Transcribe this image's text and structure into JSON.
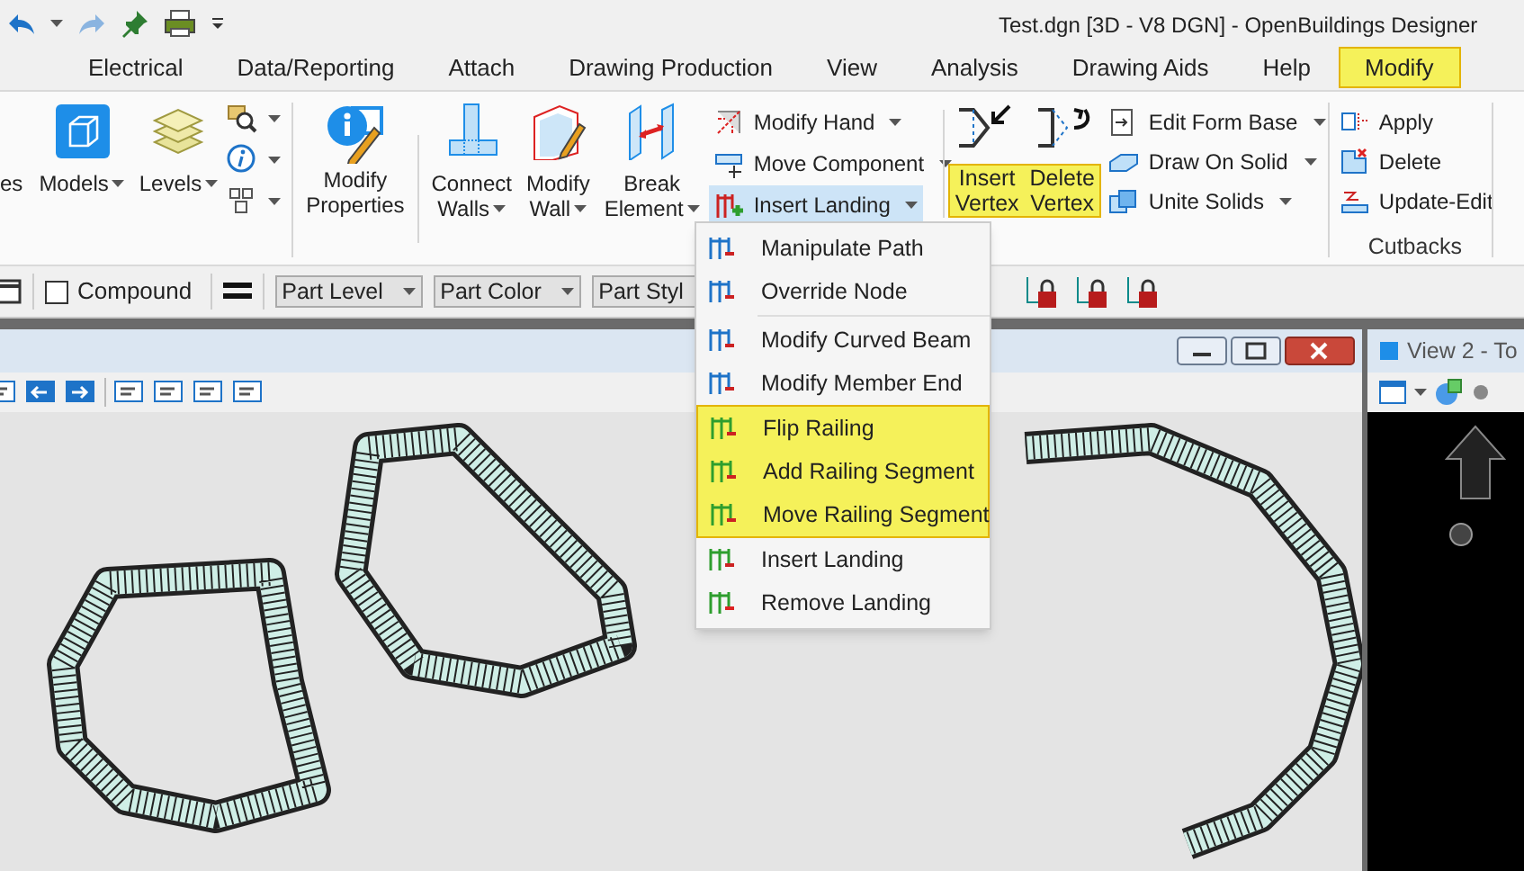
{
  "window": {
    "title": "Test.dgn [3D - V8 DGN] - OpenBuildings Designer"
  },
  "tabs": [
    {
      "label": "Electrical",
      "selected": false
    },
    {
      "label": "Data/Reporting",
      "selected": false
    },
    {
      "label": "Attach",
      "selected": false
    },
    {
      "label": "Drawing Production",
      "selected": false
    },
    {
      "label": "View",
      "selected": false
    },
    {
      "label": "Analysis",
      "selected": false
    },
    {
      "label": "Drawing Aids",
      "selected": false
    },
    {
      "label": "Help",
      "selected": false
    },
    {
      "label": "Modify",
      "selected": true
    }
  ],
  "ribbon": {
    "cut_label": "es",
    "large_buttons": [
      {
        "label": "Models",
        "kind": "models"
      },
      {
        "label": "Levels",
        "kind": "levels"
      }
    ],
    "properties_button": {
      "label_lines": [
        "Modify",
        "Properties"
      ]
    },
    "wall_buttons": [
      {
        "label_lines": [
          "Connect",
          "Walls"
        ],
        "kind": "connect"
      },
      {
        "label_lines": [
          "Modify",
          "Wall"
        ],
        "kind": "wall"
      },
      {
        "label_lines": [
          "Break",
          "Element"
        ],
        "kind": "break"
      }
    ],
    "small_buttons": [
      {
        "label": "Modify Hand",
        "open": false
      },
      {
        "label": "Move Component",
        "open": false
      },
      {
        "label": "Insert Landing",
        "open": true
      }
    ],
    "vertex_buttons": [
      {
        "label_lines": [
          "Insert",
          "Vertex"
        ],
        "highlighted": true
      },
      {
        "label_lines": [
          "Delete",
          "Vertex"
        ],
        "highlighted": true
      }
    ],
    "solid_buttons": [
      {
        "label": "Edit Form Base"
      },
      {
        "label": "Draw On Solid"
      },
      {
        "label": "Unite Solids"
      }
    ],
    "cutbacks": {
      "items": [
        "Apply",
        "Delete",
        "Update-Edit"
      ],
      "group_label": "Cutbacks"
    }
  },
  "menu": {
    "items": [
      {
        "kind": "item",
        "label": "Manipulate Path",
        "highlighted": false
      },
      {
        "kind": "item",
        "label": "Override Node",
        "highlighted": false
      },
      {
        "kind": "separator"
      },
      {
        "kind": "item",
        "label": "Modify Curved Beam",
        "highlighted": false
      },
      {
        "kind": "item",
        "label": "Modify Member End",
        "highlighted": false
      },
      {
        "kind": "item",
        "label": "Flip Railing",
        "highlighted": true
      },
      {
        "kind": "item",
        "label": "Add Railing Segment",
        "highlighted": true
      },
      {
        "kind": "item",
        "label": "Move Railing Segment",
        "highlighted": true
      },
      {
        "kind": "item",
        "label": "Insert Landing",
        "highlighted": false
      },
      {
        "kind": "item",
        "label": "Remove Landing",
        "highlighted": false
      }
    ]
  },
  "toolbar": {
    "compound": {
      "label": "Compound",
      "checked": false
    },
    "dropdowns": [
      {
        "value": "Part Level"
      },
      {
        "value": "Part Color"
      },
      {
        "value": "Part Styl"
      }
    ]
  },
  "view2": {
    "title": "View 2 - To"
  }
}
